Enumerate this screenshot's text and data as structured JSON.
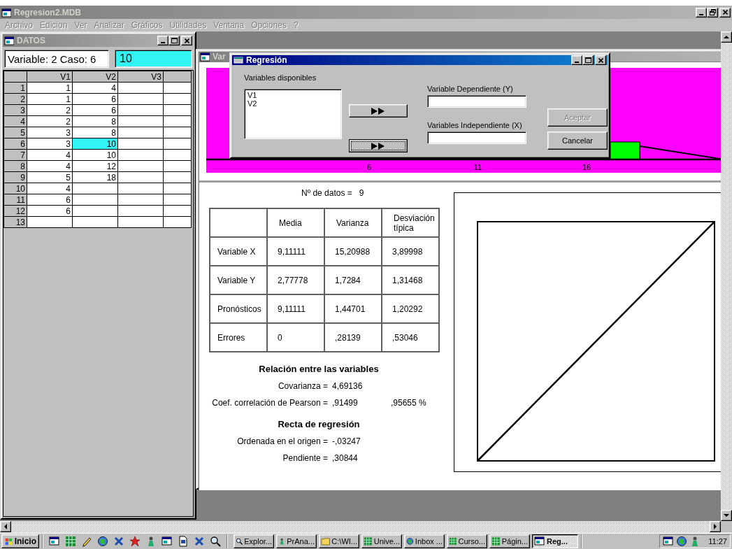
{
  "app": {
    "title": "Regresion2.MDB"
  },
  "menu": [
    {
      "label": "Archivo",
      "disabled": true
    },
    {
      "label": "Edicion",
      "disabled": true
    },
    {
      "label": "Ver",
      "disabled": true
    },
    {
      "label": "Analizar",
      "disabled": true
    },
    {
      "label": "Gráficos",
      "disabled": true
    },
    {
      "label": "Utilidades",
      "disabled": true
    },
    {
      "label": "Ventana",
      "disabled": true
    },
    {
      "label": "Opciones",
      "disabled": true
    },
    {
      "label": "?",
      "disabled": true
    }
  ],
  "datos": {
    "title": "DATOS",
    "position": "Variable: 2 Caso: 6",
    "cell_value": "10",
    "columns": [
      "V1",
      "V2",
      "V3"
    ],
    "rows": [
      {
        "num": "1",
        "cells": [
          {
            "text": "1",
            "selected": false
          },
          {
            "text": "4",
            "selected": false
          }
        ]
      },
      {
        "num": "2",
        "cells": [
          {
            "text": "1",
            "selected": false
          },
          {
            "text": "6",
            "selected": false
          }
        ]
      },
      {
        "num": "3",
        "cells": [
          {
            "text": "2",
            "selected": false
          },
          {
            "text": "6",
            "selected": false
          }
        ]
      },
      {
        "num": "4",
        "cells": [
          {
            "text": "2",
            "selected": false
          },
          {
            "text": "8",
            "selected": false
          }
        ]
      },
      {
        "num": "5",
        "cells": [
          {
            "text": "3",
            "selected": false
          },
          {
            "text": "8",
            "selected": false
          }
        ]
      },
      {
        "num": "6",
        "cells": [
          {
            "text": "3",
            "selected": false
          },
          {
            "text": "10",
            "selected": true
          }
        ]
      },
      {
        "num": "7",
        "cells": [
          {
            "text": "4",
            "selected": false
          },
          {
            "text": "10",
            "selected": false
          }
        ]
      },
      {
        "num": "8",
        "cells": [
          {
            "text": "4",
            "selected": false
          },
          {
            "text": "12",
            "selected": false
          }
        ]
      },
      {
        "num": "9",
        "cells": [
          {
            "text": "5",
            "selected": false
          },
          {
            "text": "18",
            "selected": false
          }
        ]
      },
      {
        "num": "10",
        "cells": [
          {
            "text": "4",
            "selected": false
          }
        ]
      },
      {
        "num": "11",
        "cells": [
          {
            "text": "6",
            "selected": false
          }
        ]
      },
      {
        "num": "12",
        "cells": [
          {
            "text": "6",
            "selected": false
          }
        ]
      },
      {
        "num": "13"
      }
    ]
  },
  "variables_window": {
    "title": "Var",
    "chart": {
      "tick_labels": [
        "6",
        "11",
        "16"
      ]
    },
    "stats": {
      "count_label": "Nº de datos =",
      "count": "9",
      "columns": [
        "Media",
        "Varianza",
        "Desviación típica"
      ],
      "rows": [
        {
          "label": "Variable X",
          "values": [
            "9,11111",
            "15,20988",
            "3,89998"
          ]
        },
        {
          "label": "Variable Y",
          "values": [
            "2,77778",
            "1,7284",
            "1,31468"
          ]
        },
        {
          "label": "Pronósticos",
          "values": [
            "9,11111",
            "1,44701",
            "1,20292"
          ]
        },
        {
          "label": "Errores",
          "values": [
            "0",
            ",28139",
            ",53046"
          ]
        }
      ],
      "relation_heading": "Relación entre las variables",
      "relation_lines": [
        {
          "label": "Covarianza =",
          "value": "4,69136"
        },
        {
          "label": "Coef. correlación de Pearson =",
          "value": ",91499",
          "extra": ",95655 %"
        }
      ],
      "regression_heading": "Recta de regresión",
      "regression_lines": [
        {
          "label": "Ordenada en el origen =",
          "value": "-,03247"
        },
        {
          "label": "Pendiente =",
          "value": ",30844"
        }
      ]
    }
  },
  "dialog": {
    "title": "Regresión",
    "available_label": "Variables disponibles",
    "available": [
      "V1",
      "V2"
    ],
    "move_buttons": [
      {
        "focused": false
      },
      {
        "focused": true
      }
    ],
    "dependent_label": "Variable Dependiente (Y)",
    "independent_label": "Variables Independiente (X)",
    "buttons": [
      {
        "label": "Aceptar",
        "disabled": true
      },
      {
        "label": "Cancelar",
        "disabled": false
      }
    ]
  },
  "taskbar": {
    "start": "Inicio",
    "tasks": [
      {
        "label": "Explor...",
        "selected": false
      },
      {
        "label": "PrAna...",
        "selected": false
      },
      {
        "label": "C:\\WI...",
        "selected": false
      },
      {
        "label": "Unive...",
        "selected": false
      },
      {
        "label": "Inbox ...",
        "selected": false
      },
      {
        "label": "Curso...",
        "selected": false
      },
      {
        "label": "Págin...",
        "selected": false
      },
      {
        "label": "Reg...",
        "selected": true
      }
    ],
    "clock": "11:27"
  }
}
